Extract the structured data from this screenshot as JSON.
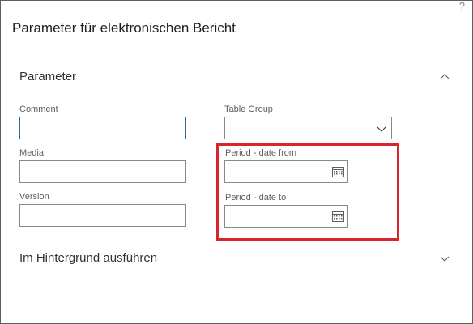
{
  "dialog": {
    "title": "Parameter für elektronischen Bericht",
    "help_label": "?"
  },
  "sections": {
    "parameters": {
      "label": "Parameter",
      "expanded": true
    },
    "background": {
      "label": "Im Hintergrund ausführen",
      "expanded": false
    }
  },
  "fields": {
    "comment": {
      "label": "Comment",
      "value": ""
    },
    "media": {
      "label": "Media",
      "value": ""
    },
    "version": {
      "label": "Version",
      "value": ""
    },
    "table_group": {
      "label": "Table Group",
      "value": ""
    },
    "period_from": {
      "label": "Period - date from",
      "value": ""
    },
    "period_to": {
      "label": "Period - date to",
      "value": ""
    }
  },
  "colors": {
    "highlight": "#d9242b",
    "focus_border": "#2b6aa8"
  },
  "icons": {
    "help": "question-mark",
    "collapse": "chevron-up",
    "expand": "chevron-down",
    "calendar": "calendar"
  }
}
